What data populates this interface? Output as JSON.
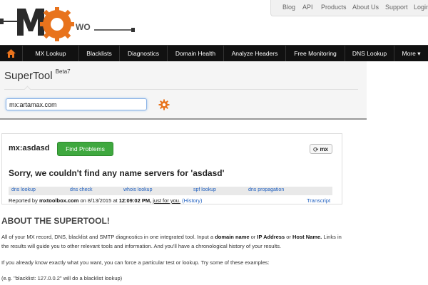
{
  "header": {
    "logo_text": "WO",
    "topnav": [
      "Blog",
      "API",
      "Products",
      "About Us",
      "Support",
      "Login"
    ]
  },
  "mainnav": {
    "home_icon": "house-icon",
    "items": [
      "MX Lookup",
      "Blacklists",
      "Diagnostics",
      "Domain Health",
      "Analyze Headers",
      "Free Monitoring",
      "DNS Lookup",
      "More ▾"
    ]
  },
  "supertool": {
    "title": "SuperTool",
    "beta": "Beta7",
    "search_value": "mx:artamax.com",
    "gear_icon": "gear-icon"
  },
  "result": {
    "query": "mx:asdasd",
    "find_button": "Find Problems",
    "mx_button": "mx",
    "refresh_icon": "refresh-icon",
    "message": "Sorry, we couldn't find any name servers for 'asdasd'",
    "links": [
      "dns lookup",
      "dns check",
      "whois lookup",
      "spf lookup",
      "dns propagation"
    ],
    "reported_prefix": "Reported by",
    "reported_site": "mxtoolbox.com",
    "reported_on": "on 8/13/2015 at",
    "reported_time": "12:09:02 PM,",
    "just_for_you": "just for you.",
    "history": "(History)",
    "transcript": "Transcript"
  },
  "about": {
    "heading": "ABOUT THE SUPERTOOL!",
    "p1_a": "All of your MX record, DNS, blacklist and SMTP diagnostics in one integrated tool.  Input a ",
    "p1_b": "domain name",
    "p1_c": " or ",
    "p1_d": "IP Address",
    "p1_e": " or ",
    "p1_f": "Host Name.",
    "p1_g": " Links in",
    "p1_line2": "the results will guide you to other relevant tools and information.  And you'll have a chronological history of your results.",
    "p2": "If you already know exactly what you want, you can force a particular test or lookup.  Try some of these examples:",
    "p3": "(e.g. \"blacklist: 127.0.0.2\" will do a blacklist lookup)"
  },
  "colors": {
    "nav_bg": "#111111",
    "logo_orange": "#e8731d",
    "find_green": "#3fa83f",
    "link_blue": "#1f5fbf"
  }
}
